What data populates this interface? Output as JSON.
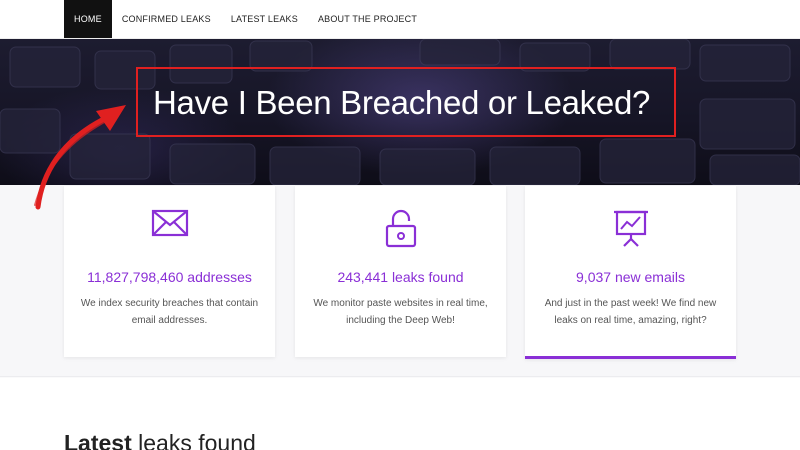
{
  "nav": {
    "items": [
      {
        "label": "HOME",
        "active": true
      },
      {
        "label": "CONFIRMED LEAKS",
        "active": false
      },
      {
        "label": "LATEST LEAKS",
        "active": false
      },
      {
        "label": "ABOUT THE PROJECT",
        "active": false
      }
    ]
  },
  "hero": {
    "title": "Have I Been Breached or Leaked?",
    "annotation_color": "#e02020"
  },
  "cards": [
    {
      "icon": "envelope-icon",
      "value": "11,827,798,460",
      "unit": "addresses",
      "desc": "We index security breaches that contain email addresses."
    },
    {
      "icon": "unlock-icon",
      "value": "243,441",
      "unit": "leaks found",
      "desc": "We monitor paste websites in real time, including the Deep Web!"
    },
    {
      "icon": "presentation-chart-icon",
      "value": "9,037",
      "unit": "new emails",
      "desc": "And just in the past week! We find new leaks on real time, amazing, right?"
    }
  ],
  "latest": {
    "bold": "Latest",
    "rest": "leaks found"
  },
  "colors": {
    "accent": "#8a2fd6",
    "nav_active_bg": "#111111"
  }
}
